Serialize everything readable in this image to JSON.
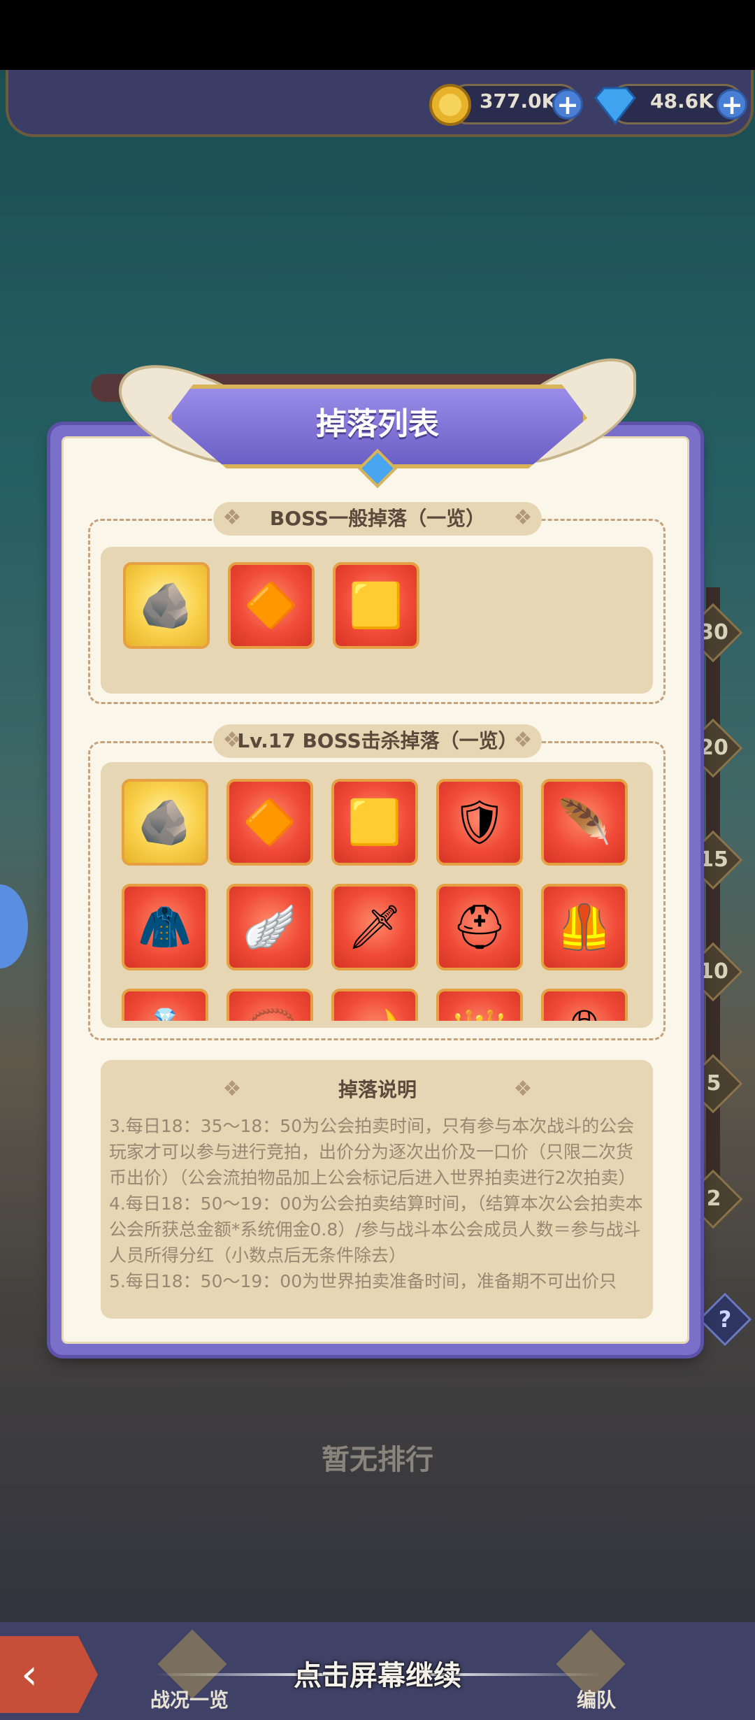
{
  "resources": {
    "coins": "377.0K",
    "gems": "48.6K"
  },
  "background": {
    "boss_name": "",
    "boss_level": "Lv.17",
    "empty_rank": "暂无排行",
    "ladder": [
      "30",
      "20",
      "15",
      "10",
      "5",
      "2"
    ]
  },
  "modal": {
    "title": "掉落列表",
    "general_section": {
      "title": "BOSS一般掉落（一览）",
      "items": [
        {
          "name": "ore-rock",
          "rarity": "gold",
          "glyph": "🪨"
        },
        {
          "name": "crystal-rock",
          "rarity": "red",
          "glyph": "🔶"
        },
        {
          "name": "gold-nuggets",
          "rarity": "red",
          "glyph": "🟨"
        }
      ]
    },
    "kill_section": {
      "title": "Lv.17 BOSS击杀掉落（一览）",
      "items": [
        {
          "name": "ore-rock",
          "rarity": "gold",
          "glyph": "🪨"
        },
        {
          "name": "crystal-rock",
          "rarity": "red",
          "glyph": "🔶"
        },
        {
          "name": "gold-nuggets",
          "rarity": "red",
          "glyph": "🟨"
        },
        {
          "name": "holy-shield",
          "rarity": "red",
          "glyph": "🛡"
        },
        {
          "name": "winged-boot",
          "rarity": "red",
          "glyph": "🪶"
        },
        {
          "name": "chest-armor",
          "rarity": "red",
          "glyph": "🧥"
        },
        {
          "name": "wing-ornament",
          "rarity": "red",
          "glyph": "🪽"
        },
        {
          "name": "dagger",
          "rarity": "red",
          "glyph": "🗡"
        },
        {
          "name": "winged-helmet",
          "rarity": "red",
          "glyph": "⛑"
        },
        {
          "name": "dark-armor",
          "rarity": "red",
          "glyph": "🦺"
        },
        {
          "name": "ring",
          "rarity": "red",
          "glyph": "💍"
        },
        {
          "name": "amulet",
          "rarity": "red",
          "glyph": "📿"
        },
        {
          "name": "horn",
          "rarity": "red",
          "glyph": "🌙"
        },
        {
          "name": "gem-crown",
          "rarity": "red",
          "glyph": "👑"
        },
        {
          "name": "belt",
          "rarity": "red",
          "glyph": "🎗"
        }
      ]
    },
    "desc_section": {
      "title": "掉落说明",
      "paragraphs": [
        "3.每日18：35～18：50为公会拍卖时间，只有参与本次战斗的公会玩家才可以参与进行竞拍，出价分为逐次出价及一口价（只限二次货币出价）（公会流拍物品加上公会标记后进入世界拍卖进行2次拍卖）",
        "4.每日18：50～19：00为公会拍卖结算时间，（结算本次公会拍卖本公会所获总金额*系统佣金0.8）/参与战斗本公会成员人数＝参与战斗人员所得分红（小数点后无条件除去）",
        "5.每日18：50～19：00为世界拍卖准备时间，准备期不可出价只"
      ]
    }
  },
  "bottom_nav": {
    "battle_overview": "战况一览",
    "continue": "点击屏幕继续",
    "team": "编队"
  }
}
